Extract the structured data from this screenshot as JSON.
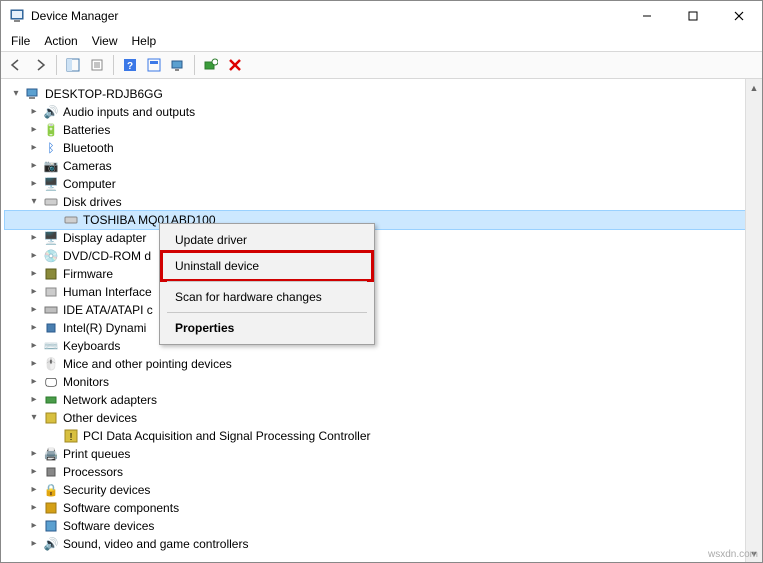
{
  "window": {
    "title": "Device Manager"
  },
  "menubar": {
    "file": "File",
    "action": "Action",
    "view": "View",
    "help": "Help"
  },
  "tree": {
    "root": "DESKTOP-RDJB6GG",
    "nodes": {
      "audio": "Audio inputs and outputs",
      "batteries": "Batteries",
      "bluetooth": "Bluetooth",
      "cameras": "Cameras",
      "computer": "Computer",
      "disk_drives": "Disk drives",
      "disk_child": "TOSHIBA MQ01ABD100",
      "display": "Display adapter",
      "dvd": "DVD/CD-ROM d",
      "firmware": "Firmware",
      "hid": "Human Interface",
      "ide": "IDE ATA/ATAPI c",
      "intel": "Intel(R) Dynami",
      "keyboards": "Keyboards",
      "mice": "Mice and other pointing devices",
      "monitors": "Monitors",
      "network": "Network adapters",
      "other": "Other devices",
      "other_child": "PCI Data Acquisition and Signal Processing Controller",
      "print": "Print queues",
      "processors": "Processors",
      "security": "Security devices",
      "software_components": "Software components",
      "software_devices": "Software devices",
      "sound": "Sound, video and game controllers"
    }
  },
  "context_menu": {
    "update": "Update driver",
    "uninstall": "Uninstall device",
    "scan": "Scan for hardware changes",
    "properties": "Properties"
  },
  "watermark": "wsxdn.com"
}
